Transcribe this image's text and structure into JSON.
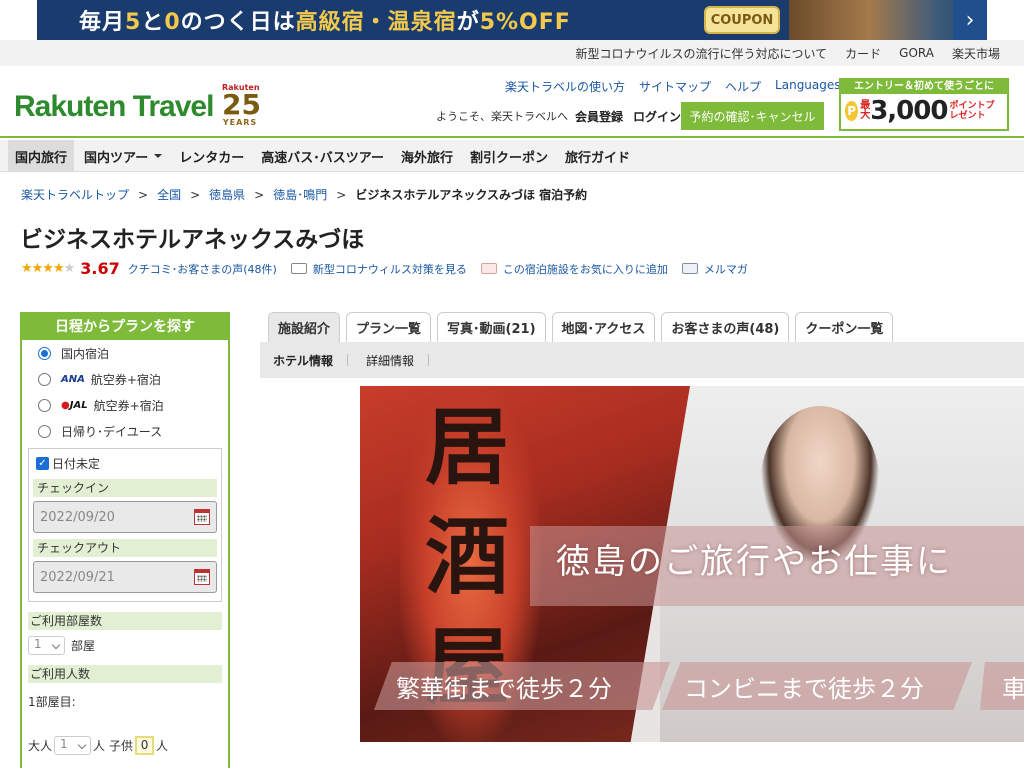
{
  "banner": {
    "text_pre": "毎月",
    "text_d1": "5",
    "text_and": "と",
    "text_d2": "0",
    "text_mid": "のつく日は",
    "text_hl1": "高級宿・温泉宿",
    "text_ga": "が",
    "text_off": "5%OFF",
    "coupon_label": "COUPON",
    "next_icon": "chevron-right-icon"
  },
  "util_bar": {
    "links": [
      "新型コロナウイルスの流行に伴う対応について",
      "カード",
      "GORA",
      "楽天市場"
    ]
  },
  "header": {
    "logo_text": "Rakuten Travel",
    "anniv": {
      "brand": "Rakuten",
      "number": "25",
      "label": "YEARS"
    },
    "links": [
      "楽天トラベルの使い方",
      "サイトマップ",
      "ヘルプ",
      "Languages"
    ],
    "welcome": "ようこそ、楽天トラベルへ",
    "register": "会員登録",
    "login": "ログイン",
    "reserve_button": "予約の確認･キャンセル",
    "promo": {
      "top": "エントリー＆初めて使うごとに",
      "coin": "P",
      "max": "最大",
      "points": "3,000",
      "pt_label": "ポイントプレゼント"
    }
  },
  "gnav": {
    "items": [
      "国内旅行",
      "国内ツアー",
      "レンタカー",
      "高速バス･バスツアー",
      "海外旅行",
      "割引クーポン",
      "旅行ガイド"
    ]
  },
  "breadcrumb": {
    "items": [
      "楽天トラベルトップ",
      "全国",
      "徳島県",
      "徳島･鳴門"
    ],
    "current": "ビジネスホテルアネックスみづほ 宿泊予約"
  },
  "hotel": {
    "title": "ビジネスホテルアネックスみづほ",
    "rating": 3.67,
    "score_text": "3.67",
    "review_label": "クチコミ･お客さまの声",
    "review_count": "(48件)",
    "covid_link": "新型コロナウィルス対策を見る",
    "fav_link": "この宿泊施設をお気に入りに追加",
    "mail_link": "メルマガ"
  },
  "search": {
    "heading": "日程からプランを探す",
    "options": [
      {
        "label": "国内宿泊",
        "airline": "",
        "selected": true
      },
      {
        "label": "航空券+宿泊",
        "airline": "ANA",
        "selected": false
      },
      {
        "label": "航空券+宿泊",
        "airline": "JAL",
        "selected": false
      },
      {
        "label": "日帰り･デイユース",
        "airline": "",
        "selected": false
      }
    ],
    "undecided_label": "日付未定",
    "undecided_checked": true,
    "checkin_label": "チェックイン",
    "checkin_value": "2022/09/20",
    "checkout_label": "チェックアウト",
    "checkout_value": "2022/09/21",
    "rooms_label": "ご利用部屋数",
    "rooms_value": "1",
    "rooms_unit": "部屋",
    "people_label": "ご利用人数",
    "room1_label": "1部屋目:",
    "adult_label": "大人",
    "adult_value": "1",
    "person_unit": "人",
    "child_label": "子供",
    "child_value": "0",
    "person_unit2": "人"
  },
  "tabs": [
    {
      "label": "施設紹介",
      "active": true
    },
    {
      "label": "プラン一覧",
      "active": false
    },
    {
      "label": "写真･動画(21)",
      "active": false
    },
    {
      "label": "地図･アクセス",
      "active": false
    },
    {
      "label": "お客さまの声(48)",
      "active": false
    },
    {
      "label": "クーポン一覧",
      "active": false
    }
  ],
  "subtabs": [
    {
      "label": "ホテル情報",
      "active": true
    },
    {
      "label": "詳細情報",
      "active": false
    }
  ],
  "hero": {
    "kanji": "居酒屋",
    "caption": "徳島のご旅行やお仕事に",
    "tags": [
      "繁華街まで徒歩２分",
      "コンビニまで徒歩２分",
      "車"
    ]
  },
  "colors": {
    "brand_green": "#7fbb3a",
    "link_blue": "#1a57a3",
    "rating_red": "#cc0000",
    "star_gold": "#f0a500"
  }
}
